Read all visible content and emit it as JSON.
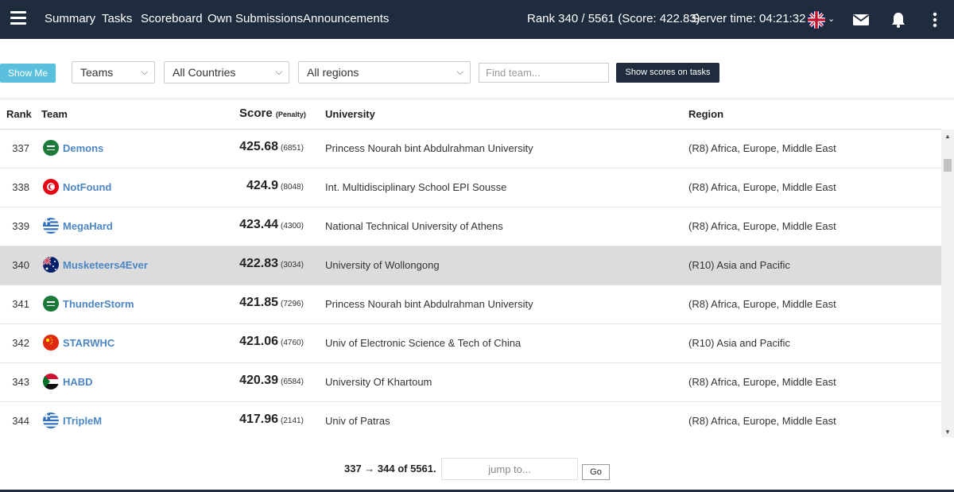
{
  "nav": {
    "links": [
      "Summary",
      "Tasks",
      "Scoreboard",
      "Own Submissions",
      "Announcements"
    ],
    "rank_status": "Rank 340 / 5561 (Score: 422.83)",
    "server_time": "Server time: 04:21:32"
  },
  "toolbar": {
    "show_me": "Show Me",
    "group_select": "Teams",
    "country_select": "All Countries",
    "region_select": "All regions",
    "search_placeholder": "Find team...",
    "show_scores": "Show scores on tasks"
  },
  "table": {
    "headers": {
      "rank": "Rank",
      "team": "Team",
      "score": "Score",
      "penalty": "(Penalty)",
      "university": "University",
      "region": "Region"
    },
    "rows": [
      {
        "rank": "337",
        "flag": "saudi-arabia-flag",
        "team": "Demons",
        "score": "425.68",
        "penalty": "(6851)",
        "university": "Princess Nourah bint Abdulrahman University",
        "region": "(R8) Africa, Europe, Middle East"
      },
      {
        "rank": "338",
        "flag": "tunisia-flag",
        "team": "NotFound",
        "score": "424.9",
        "penalty": "(8048)",
        "university": "Int. Multidisciplinary School EPI Sousse",
        "region": "(R8) Africa, Europe, Middle East"
      },
      {
        "rank": "339",
        "flag": "greece-flag",
        "team": "MegaHard",
        "score": "423.44",
        "penalty": "(4300)",
        "university": "National Technical University of Athens",
        "region": "(R8) Africa, Europe, Middle East"
      },
      {
        "rank": "340",
        "flag": "australia-flag",
        "team": "Musketeers4Ever",
        "score": "422.83",
        "penalty": "(3034)",
        "university": "University of Wollongong",
        "region": "(R10) Asia and Pacific"
      },
      {
        "rank": "341",
        "flag": "saudi-arabia-flag",
        "team": "ThunderStorm",
        "score": "421.85",
        "penalty": "(7296)",
        "university": "Princess Nourah bint Abdulrahman University",
        "region": "(R8) Africa, Europe, Middle East"
      },
      {
        "rank": "342",
        "flag": "china-flag",
        "team": "STARWHC",
        "score": "421.06",
        "penalty": "(4760)",
        "university": "Univ of Electronic Science & Tech of China",
        "region": "(R10) Asia and Pacific"
      },
      {
        "rank": "343",
        "flag": "sudan-flag",
        "team": "HABD",
        "score": "420.39",
        "penalty": "(6584)",
        "university": "University Of Khartoum",
        "region": "(R8) Africa, Europe, Middle East"
      },
      {
        "rank": "344",
        "flag": "greece-flag",
        "team": "ITripleM",
        "score": "417.96",
        "penalty": "(2141)",
        "university": "Univ of Patras",
        "region": "(R8) Africa, Europe, Middle East"
      }
    ]
  },
  "pager": {
    "range": "337 → 344 of 5561.",
    "jump_placeholder": "jump to...",
    "go": "Go"
  },
  "colors": {
    "navbar": "#1f2c3d",
    "accent": "#5bc0de",
    "team_link": "#4d86c4",
    "highlight_row": "#dcdcdc"
  }
}
